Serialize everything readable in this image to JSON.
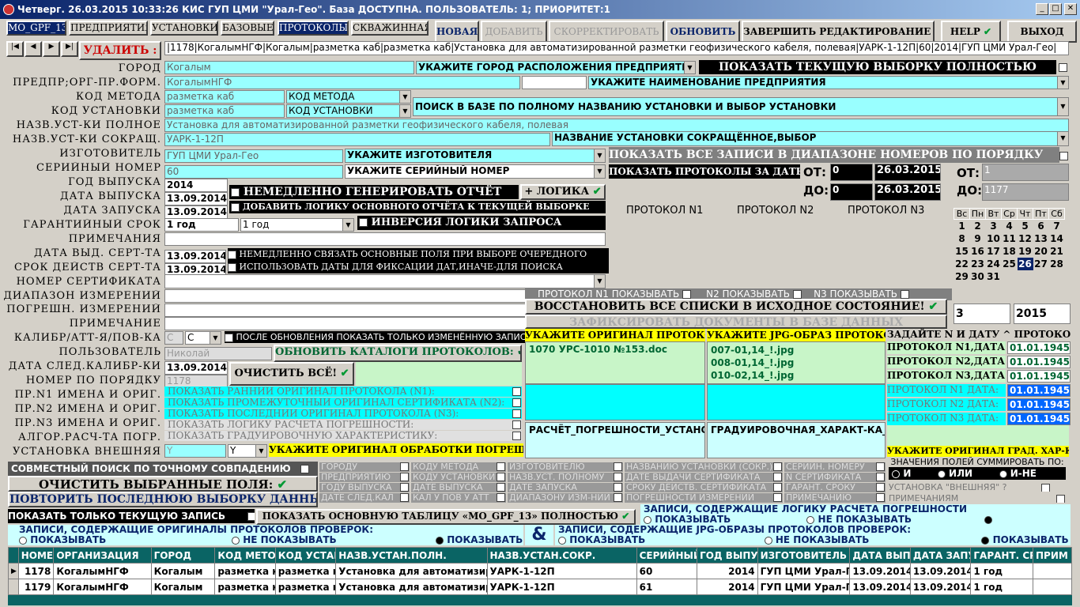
{
  "title": "Четверг. 26.03.2015 10:33:26 КИС ГУП ЦМИ \"Урал-Гео\". База ДОСТУПНА. ПОЛЬЗОВАТЕЛЬ: 1; ПРИОРИТЕТ:1",
  "tabs": [
    "MO_GPF_13",
    "ПРЕДПРИЯТИЯ",
    "УСТАНОВКИ",
    "БАЗОВЫЕ",
    "ПРОТОКОЛЫ",
    "СКВАЖИННАЯ"
  ],
  "actions": {
    "new": "НОВАЯ",
    "add": "ДОБАВИТЬ",
    "edit": "СКОРРЕКТИРОВАТЬ",
    "refresh": "ОБНОВИТЬ",
    "finish": "ЗАВЕРШИТЬ РЕДАКТИРОВАНИЕ БАЗЫ",
    "help": "HELP",
    "exit": "ВЫХОД"
  },
  "delete_label": "УДАЛИТЬ :",
  "record_line": "|1178|КогалымНГФ|Когалым|разметка каб|разметка каб|Установка для автоматизированной разметки геофизического кабеля, полевая|УАРК-1-12П|60|2014|ГУП ЦМИ Урал-Гео|",
  "labels": [
    "ГОРОД",
    "ПРЕДПР;ОРГ-ПР.ФОРМ.",
    "КОД МЕТОДА",
    "КОД УСТАНОВКИ",
    "НАЗВ.УСТ-КИ ПОЛНОЕ",
    "НАЗВ.УСТ-КИ СОКРАЩ.",
    "ИЗГОТОВИТЕЛЬ",
    "СЕРИЙНЫЙ НОМЕР",
    "ГОД ВЫПУСКА",
    "ДАТА ВЫПУСКА",
    "ДАТА ЗАПУСКА",
    "ГАРАНТИЙНЫЙ СРОК",
    "ПРИМЕЧАНИЯ",
    "ДАТА ВЫД. СЕРТ-ТА",
    "СРОК ДЕЙСТВ СЕРТ-ТА",
    "НОМЕР СЕРТИФИКАТА",
    "ДИАПАЗОН ИЗМЕРЕНИЙ",
    "ПОГРЕШН. ИЗМЕРЕНИЙ",
    "ПРИМЕЧАНИЕ",
    "КАЛИБР/АТТ-Я/ПОВ-КА",
    "ПОЛЬЗОВАТЕЛЬ",
    "ДАТА СЛЕД.КАЛИБР-КИ",
    "НОМЕР ПО ПОРЯДКУ",
    "ПР.N1 ИМЕНА И ОРИГ.",
    "ПР.N2 ИМЕНА И ОРИГ.",
    "ПР.N3 ИМЕНА И ОРИГ.",
    "АЛГОР.РАСЧ-ТА ПОГР.",
    "УСТАНОВКА ВНЕШНЯЯ"
  ],
  "values": {
    "city": "Когалым",
    "org": "КогалымНГФ",
    "method": "разметка каб",
    "install_code": "разметка каб",
    "full_name": "Установка для автоматизированной разметки геофизического кабеля, полевая",
    "short_name": "УАРК-1-12П",
    "maker": "ГУП ЦМИ Урал-Гео",
    "serial": "60",
    "year": "2014",
    "release_date": "13.09.2014",
    "start_date": "13.09.2014",
    "warranty": "1 год",
    "warranty_sel": "1 год",
    "cert_issue": "13.09.2014",
    "cert_valid": "13.09.2014",
    "calib": "С",
    "calib_sel": "С",
    "user": "Николай",
    "next_calib": "13.09.2014",
    "order_no": "1178",
    "external": "Y",
    "external_sel": "Y"
  },
  "hints": {
    "city": "УКАЖИТЕ ГОРОД РАСПОЛОЖЕНИЯ ПРЕДПРИЯТИЯ",
    "org": "УКАЖИТЕ НАИМЕНОВАНИЕ ПРЕДПРИЯТИЯ",
    "method": "КОД МЕТОДА",
    "install": "КОД УСТАНОВКИ",
    "search": "ПОИСК В БАЗЕ ПО ПОЛНОМУ НАЗВАНИЮ УСТАНОВКИ И ВЫБОР УСТАНОВКИ",
    "short": "НАЗВАНИЕ УСТАНОВКИ СОКРАЩЁННОЕ,ВЫБОР",
    "maker": "УКАЖИТЕ ИЗГОТОВИТЕЛЯ",
    "serial": "УКАЖИТЕ СЕРИЙНЫЙ НОМЕР"
  },
  "show_all": "ПОКАЗАТЬ ТЕКУЩУЮ ВЫБОРКУ ПОЛНОСТЬЮ",
  "show_range": "ПОКАЗАТЬ ВСЕ ЗАПИСИ В ДИАПАЗОНЕ НОМЕРОВ ПО ПОРЯДКУ",
  "show_dates": "ПОКАЗАТЬ ПРОТОКОЛЫ ЗА ДАТЫ",
  "from": "ОТ:",
  "to": "ДО:",
  "from_n": "0",
  "to_n": "0",
  "from_date": "26.03.2015",
  "to_date": "26.03.2015",
  "range_from": "1",
  "range_to": "1177",
  "gen_report": "НЕМЕДЛЕННО ГЕНЕРИРОВАТЬ ОТЧЁТ",
  "logic": "+ ЛОГИКА",
  "add_logic": "ДОБАВИТЬ ЛОГИКУ ОСНОВНОГО ОТЧЁТА К ТЕКУЩЕЙ ВЫБОРКЕ",
  "inversion": "ИНВЕРСИЯ ЛОГИКИ ЗАПРОСА",
  "link_fields": "НЕМЕДЛЕННО СВЯЗАТЬ ОСНОВНЫЕ ПОЛЯ ПРИ ВЫБОРЕ ОЧЕРЕДНОГО",
  "use_dates": "ИСПОЛЬЗОВАТЬ ДАТЫ ДЛЯ ФИКСАЦИИ ДАТ,ИНАЧЕ-ДЛЯ ПОИСКА",
  "protocols": [
    "ПРОТОКОЛ N1",
    "ПРОТОКОЛ N2",
    "ПРОТОКОЛ N3"
  ],
  "proto_show": [
    "ПРОТОКОЛ N1 ПОКАЗЫВАТЬ",
    "N2 ПОКАЗЫВАТЬ",
    "N3 ПОКАЗЫВАТЬ"
  ],
  "restore": "ВОССТАНОВИТЬ ВСЕ СПИСКИ В ИСХОДНОЕ СОСТОЯНИЕ!",
  "fix_docs": "ЗАФИКСИРОВАТЬ ДОКУМЕНТЫ В БАЗЕ ДАННЫХ",
  "cal": {
    "days": [
      "Вс",
      "Пн",
      "Вт",
      "Ср",
      "Чт",
      "Пт",
      "Сб"
    ],
    "weeks": [
      [
        "1",
        "2",
        "3",
        "4",
        "5",
        "6",
        "7"
      ],
      [
        "8",
        "9",
        "10",
        "11",
        "12",
        "13",
        "14"
      ],
      [
        "15",
        "16",
        "17",
        "18",
        "19",
        "20",
        "21"
      ],
      [
        "22",
        "23",
        "24",
        "25",
        "26",
        "27",
        "28"
      ],
      [
        "29",
        "30",
        "31",
        "",
        "",
        "",
        ""
      ]
    ],
    "selected": "26",
    "month": "3",
    "year": "2015"
  },
  "after_update": "ПОСЛЕ ОБНОВЛЕНИЯ ПОКАЗАТЬ ТОЛЬКО ИЗМЕНЁННУЮ ЗАПИСЬ",
  "update_catalogs": "ОБНОВИТЬ КАТАЛОГИ ПРОТОКОЛОВ:",
  "clear_all": "ОЧИСТИТЬ ВСЁ!",
  "orig_header": "УКАЖИТЕ ОРИГИНАЛ ПРОТОКОЛА",
  "jpg_header": "УКАЖИТЕ JPG-ОБРАЗ ПРОТОКОЛА",
  "date_header": "ЗАДАЙТЕ N И ДАТУ ^ ПРОТОКОЛА",
  "orig_file": "1070 УРС-1010 №153.doc",
  "jpg_files": [
    "007-01,14_!.jpg",
    "008-01,14_!.jpg",
    "010-02,14_!.jpg"
  ],
  "proto_dates": [
    {
      "label": "ПРОТОКОЛ N1,ДАТА:",
      "value": "01.01.1945"
    },
    {
      "label": "ПРОТОКОЛ N2,ДАТА:",
      "value": "01.01.1945"
    },
    {
      "label": "ПРОТОКОЛ N3,ДАТА:",
      "value": "01.01.1945"
    }
  ],
  "proto_dates2": [
    {
      "label": "ПРОТОКОЛ N1 ДАТА:",
      "value": "01.01.1945"
    },
    {
      "label": "ПРОТОКОЛ N2 ДАТА:",
      "value": "01.01.1945"
    },
    {
      "label": "ПРОТОКОЛ N3 ДАТА:",
      "value": "01.01.1945"
    }
  ],
  "show_links": [
    "ПОКАЗАТЬ РАННИЙ ОРИГИНАЛ ПРОТОКОЛА (N1):",
    "ПОКАЗАТЬ ПРОМЕЖУТОЧНЫЙ ОРИГИНАЛ СЕРТИФИКАТА (N2):",
    "ПОКАЗАТЬ ПОСЛЕДНИЙ ОРИГИНАЛ ПРОТОКОЛА (N3):",
    "ПОКАЗАТЬ ЛОГИКУ РАСЧЕТА ПОГРЕШНОСТИ:",
    "ПОКАЗАТЬ ГРАДУИРОВОЧНУЮ ХАРАКТЕРИСТИКУ:"
  ],
  "calc_error": "РАСЧЁТ_ПОГРЕШНОСТИ_УСТАНОВК",
  "grad_char": "ГРАДУИРОВОЧНАЯ_ХАРАКТ-КА_УС",
  "specify_grad": "УКАЖИТЕ ОРИГИНАЛ ГРАД. ХАР-КИ",
  "specify_calc": "УКАЖИТЕ ОРИГИНАЛ ОБРАБОТКИ ПОГРЕШНОСТИ",
  "joint_search": "СОВМЕСТНЫЙ ПОИСК ПО ТОЧНОМУ СОВПАДЕНИЮ",
  "clear_fields": "ОЧИСТИТЬ ВЫБРАННЫЕ ПОЛЯ:",
  "repeat": "ПОВТОРИТЬ ПОСЛЕДНЮЮ ВЫБОРКУ ДАННЫХ",
  "field_checks": [
    [
      "ГОРОДУ",
      "ПРЕДПРИЯТИЮ",
      "ГОДУ ВЫПУСКА",
      "ДАТЕ СЛЕД.КАЛ"
    ],
    [
      "КОДУ МЕТОДА",
      "КОДУ УСТАНОВКИ",
      "ДАТЕ ВЫПУСКА",
      "КАЛ У ПОВ У АТТ"
    ],
    [
      "ИЗГОТОВИТЕЛЮ",
      "НАЗВ.УСТ. ПОЛНОМУ",
      "ДАТЕ ЗАПУСКА",
      "ДИАПАЗОНУ ИЗМ-НИЙ"
    ],
    [
      "НАЗВАНИЮ УСТАНОВКИ (СОКР.)",
      "ДАТЕ ВЫДАЧИ СЕРТИФИКАТА",
      "СРОКУ ДЕЙСТВ. СЕРТИФИКАТА",
      "ПОГРЕШНОСТИ ИЗМЕРЕНИЙ"
    ],
    [
      "СЕРИЙН. НОМЕРУ",
      "N СЕРТИФИКАТА",
      "ГАРАНТ. СРОКУ",
      "ПРИМЕЧАНИЮ"
    ]
  ],
  "sum_title": "ЗНАЧЕНИЯ ПОЛЕЙ СУММИРОВАТЬ ПО:",
  "sum_opts": [
    "И",
    "ИЛИ",
    "И-НЕ"
  ],
  "external_check": "УСТАНОВКА \"ВНЕШНЯЯ\" ?",
  "notes_check": "ПРИМЕЧАНИЯМ",
  "only_current": "ПОКАЗАТЬ ТОЛЬКО ТЕКУЩУЮ ЗАПИСЬ",
  "show_main": "ПОКАЗАТЬ ОСНОВНУЮ ТАБЛИЦУ «MO_GPF_13» ПОЛНОСТЬЮ",
  "logic_records": "ЗАПИСИ, СОДЕРЖАЩИЕ ЛОГИКУ РАСЧЁТА ПОГРЕШНОСТИ",
  "orig_records": "ЗАПИСИ, СОДЕРЖАЩИЕ ОРИГИНАЛЫ ПРОТОКОЛОВ ПРОВЕРОК:",
  "jpg_records": "ЗАПИСИ, СОДЕРЖАЩИЕ JPG-ОБРАЗЫ ПРОТОКОЛОВ ПРОВЕРОК:",
  "show_opts": [
    "ПОКАЗЫВАТЬ",
    "НЕ ПОКАЗЫВАТЬ",
    "ПОКАЗЫВАТЬ ВСЕ"
  ],
  "amp": "&",
  "grid": {
    "cols": [
      "НОМЕР",
      "ОРГАНИЗАЦИЯ",
      "ГОРОД",
      "КОД МЕТОД",
      "КОД УСТАН",
      "НАЗВ.УСТАН.ПОЛН.",
      "НАЗВ.УСТАН.СОКР.",
      "СЕРИЙНЫЙ",
      "ГОД ВЫПУСК",
      "ИЗГОТОВИТЕЛЬ",
      "ДАТА ВЫПУ",
      "ДАТА ЗАПУ",
      "ГАРАНТ. СР",
      "ПРИМ"
    ],
    "rows": [
      [
        "1178",
        "КогалымНГФ",
        "Когалым",
        "разметка ка",
        "разметка ка",
        "Установка для автоматизиров",
        "УАРК-1-12П",
        "60",
        "2014",
        "ГУП ЦМИ Урал-Гео",
        "13.09.2014",
        "13.09.2014",
        "1 год",
        ""
      ],
      [
        "1179",
        "КогалымНГФ",
        "Когалым",
        "разметка ка",
        "разметка ка",
        "Установка для автоматизиров",
        "УАРК-1-12П",
        "61",
        "2014",
        "ГУП ЦМИ Урал-Гео",
        "13.09.2014",
        "13.09.2014",
        "1 год",
        ""
      ]
    ]
  }
}
